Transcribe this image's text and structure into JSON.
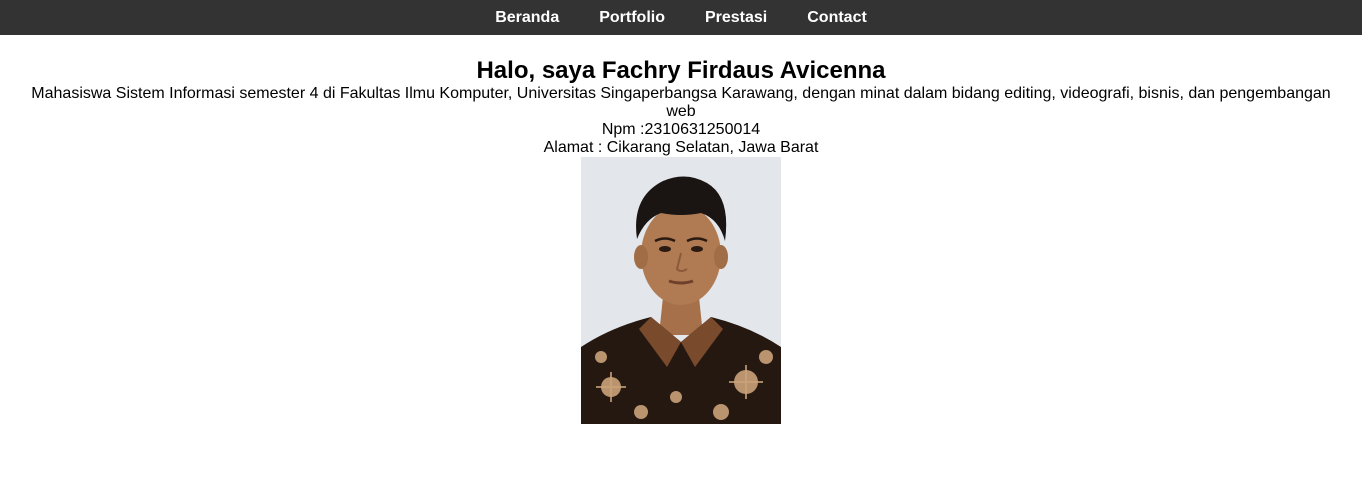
{
  "nav": {
    "items": [
      {
        "label": "Beranda"
      },
      {
        "label": "Portfolio"
      },
      {
        "label": "Prestasi"
      },
      {
        "label": "Contact"
      }
    ]
  },
  "hero": {
    "title": "Halo, saya Fachry Firdaus Avicenna",
    "description": "Mahasiswa Sistem Informasi semester 4 di Fakultas Ilmu Komputer, Universitas Singaperbangsa Karawang, dengan minat dalam bidang editing, videografi, bisnis, dan pengembangan web",
    "npm": "Npm :2310631250014",
    "address": "Alamat : Cikarang Selatan, Jawa Barat"
  },
  "colors": {
    "navbar_bg": "#333333",
    "nav_text": "#ffffff",
    "page_bg": "#ffffff",
    "photo_bg": "#e3e6ea"
  }
}
